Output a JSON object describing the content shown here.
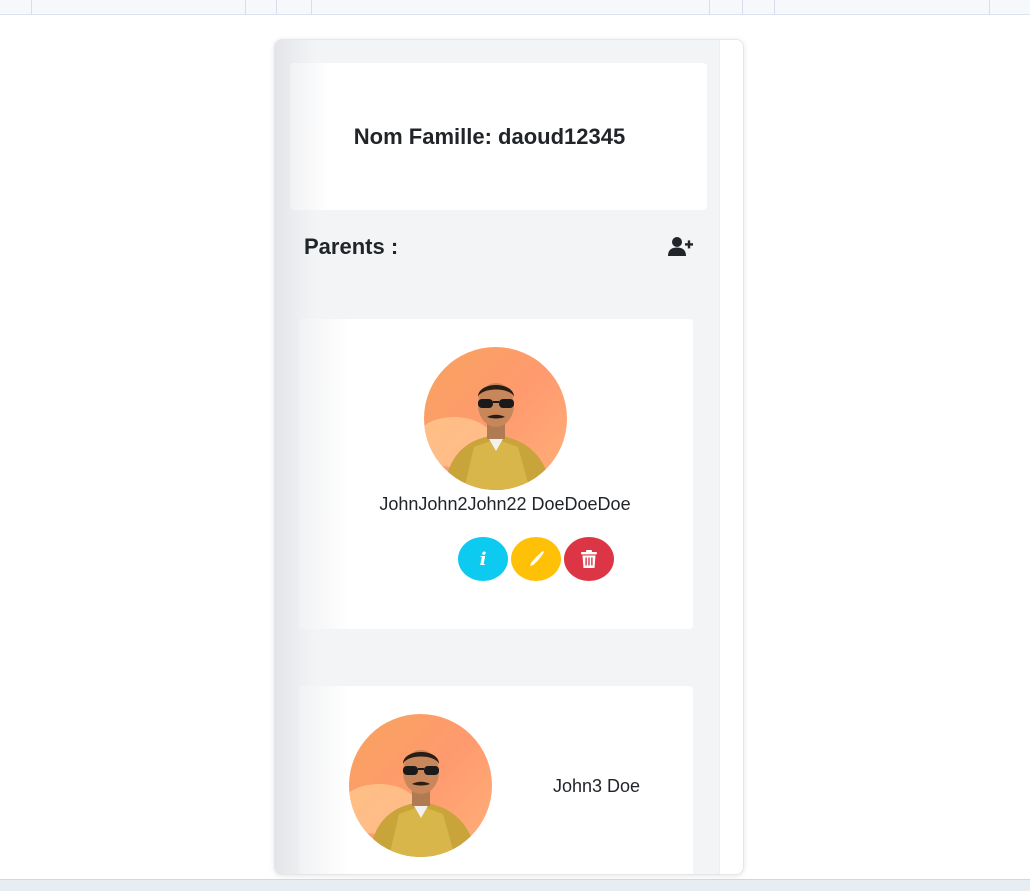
{
  "family": {
    "title": "Nom Famille: daoud12345"
  },
  "parents_section": {
    "title": "Parents :",
    "add_icon": "user-plus-icon"
  },
  "parents": [
    {
      "name": "JohnJohn2John22 DoeDoeDoe",
      "avatar": "avatar-illustration"
    },
    {
      "name": "John3 Doe",
      "avatar": "avatar-illustration"
    }
  ],
  "actions": {
    "info_icon": "info-icon",
    "info_glyph": "i",
    "edit_icon": "pencil-icon",
    "delete_icon": "trash-icon"
  },
  "colors": {
    "info": "#0dcaf0",
    "edit": "#ffc107",
    "delete": "#dc3545"
  }
}
